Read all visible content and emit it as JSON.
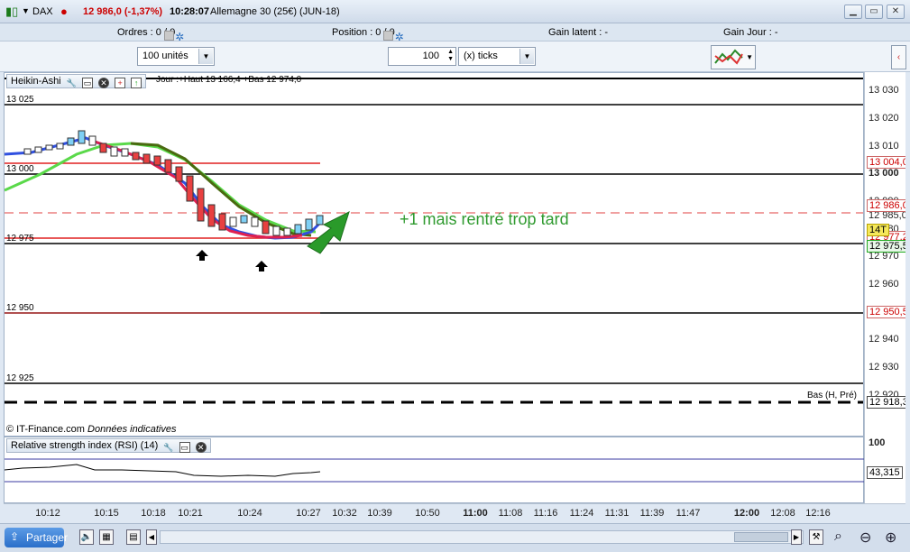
{
  "titlebar": {
    "instrument": "DAX",
    "price": "12 986,0 (-1,37%)",
    "time": "10:28:07",
    "contract": "Allemagne 30 (25€) (JUN-18)"
  },
  "status": {
    "orders_label": "Ordres : 0",
    "orders_count": "/ 0",
    "position_label": "Position : 0",
    "position_count": "/ 0",
    "gain_latent": "Gain latent :  -",
    "gain_jour": "Gain Jour :  -"
  },
  "toolbar": {
    "units_select": "100 unités",
    "quantity_value": "100",
    "ticks_select": "(x) ticks"
  },
  "chart": {
    "type_label": "Heikin-Ashi",
    "info_text": "Jour :+Haut 13 166,4 +Bas 12 974,0",
    "copyright": "© IT-Finance.com",
    "data_note": "Données indicatives",
    "annotation": "+1 mais rentré trop tard",
    "low_label": "Bas (H, Pré)",
    "level_labels": [
      "13 025",
      "13 000",
      "12 975",
      "12 950",
      "12 925"
    ],
    "colors": {
      "annotation": "#2f9a2f",
      "arrow": "#2a9a2a",
      "red_line": "#e02020"
    }
  },
  "rsi": {
    "title": "Relative strength index (RSI) (14)",
    "value": "43,315",
    "level_100": "100"
  },
  "yaxis": {
    "ticks": [
      "13 030",
      "13 020",
      "13 010",
      "13 000",
      "12 990",
      "12 985,0",
      "12 980",
      "12 975,5",
      "12 970",
      "12 960",
      "12 950,5",
      "12 940",
      "12 930",
      "12 920",
      "12 918,3"
    ],
    "badges": {
      "b13004": "13 004,0",
      "b12986": "12 986,0",
      "b12977": "12 977,2",
      "b14t": "14T",
      "b12975": "12 975,5",
      "b12950": "12 950,5",
      "b12918": "12 918,3"
    }
  },
  "xaxis": {
    "ticks": [
      "10:12",
      "10:15",
      "10:18",
      "10:21",
      "10:24",
      "10:27",
      "10:32",
      "10:39",
      "10:50",
      "11:00",
      "11:08",
      "11:16",
      "11:24",
      "11:31",
      "11:39",
      "11:47",
      "12:00",
      "12:08",
      "12:16"
    ]
  },
  "bottombar": {
    "share_label": "Partager"
  }
}
